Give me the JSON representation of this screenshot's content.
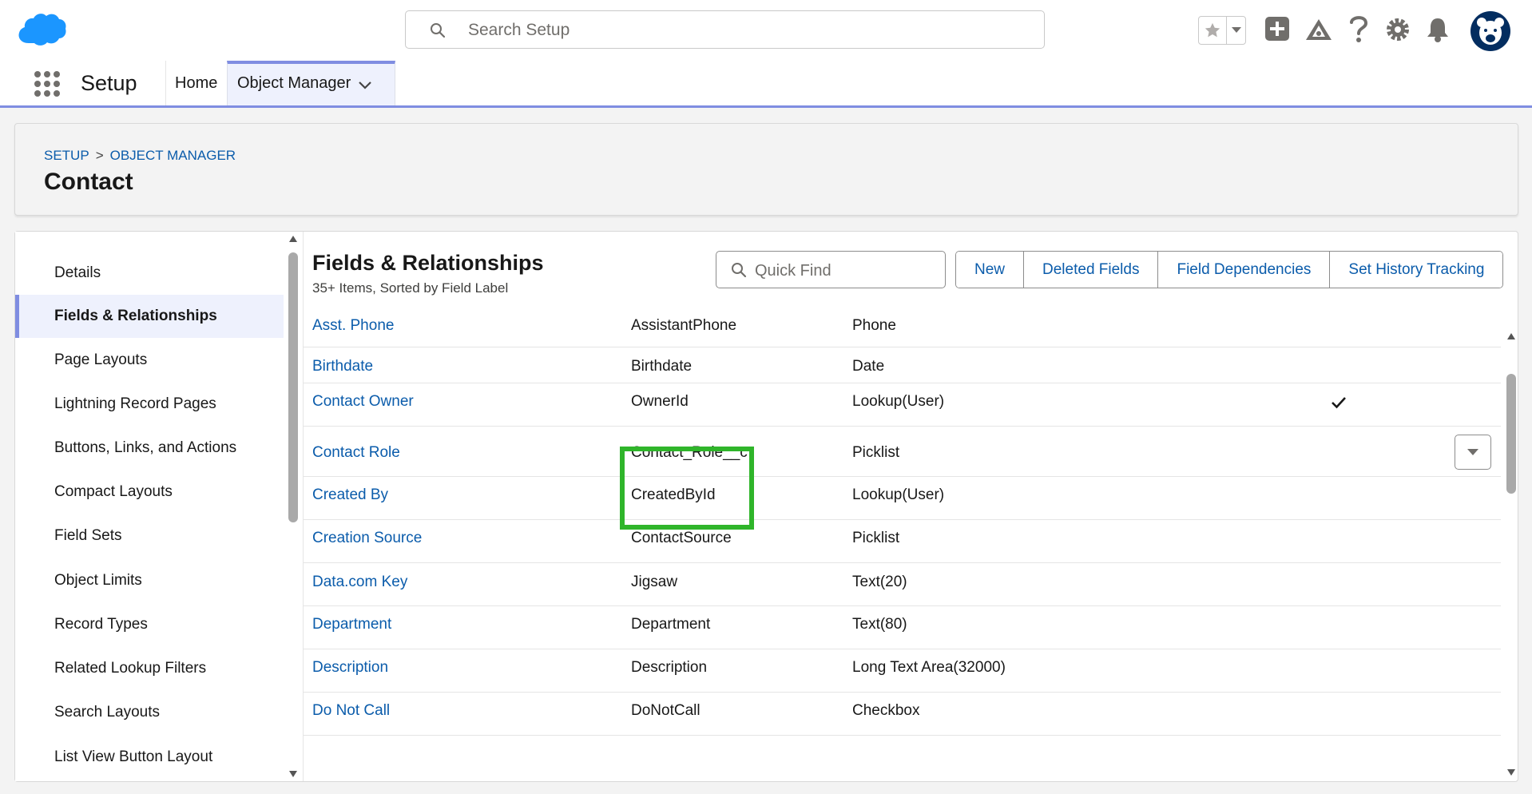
{
  "header": {
    "search_placeholder": "Search Setup"
  },
  "app_nav": {
    "app_name": "Setup",
    "tabs": [
      {
        "label": "Home"
      },
      {
        "label": "Object Manager"
      }
    ]
  },
  "page_header": {
    "breadcrumb": [
      "SETUP",
      "OBJECT MANAGER"
    ],
    "breadcrumb_sep": ">",
    "title": "Contact"
  },
  "sidebar": {
    "items": [
      {
        "label": "Details"
      },
      {
        "label": "Fields & Relationships",
        "active": true
      },
      {
        "label": "Page Layouts"
      },
      {
        "label": "Lightning Record Pages"
      },
      {
        "label": "Buttons, Links, and Actions"
      },
      {
        "label": "Compact Layouts"
      },
      {
        "label": "Field Sets"
      },
      {
        "label": "Object Limits"
      },
      {
        "label": "Record Types"
      },
      {
        "label": "Related Lookup Filters"
      },
      {
        "label": "Search Layouts"
      },
      {
        "label": "List View Button Layout"
      }
    ]
  },
  "section": {
    "title": "Fields & Relationships",
    "subtitle": "35+ Items, Sorted by Field Label",
    "quick_find_placeholder": "Quick Find",
    "buttons": [
      "New",
      "Deleted Fields",
      "Field Dependencies",
      "Set History Tracking"
    ]
  },
  "fields": [
    {
      "label": "Asst. Phone",
      "api_name": "AssistantPhone",
      "type": "Phone",
      "indexed": false
    },
    {
      "label": "Birthdate",
      "api_name": "Birthdate",
      "type": "Date",
      "indexed": false
    },
    {
      "label": "Contact Owner",
      "api_name": "OwnerId",
      "type": "Lookup(User)",
      "indexed": true
    },
    {
      "label": "Contact Role",
      "api_name": "Contact_Role__c",
      "type": "Picklist",
      "indexed": false,
      "has_action_menu": true
    },
    {
      "label": "Created By",
      "api_name": "CreatedById",
      "type": "Lookup(User)",
      "indexed": false
    },
    {
      "label": "Creation Source",
      "api_name": "ContactSource",
      "type": "Picklist",
      "indexed": false
    },
    {
      "label": "Data.com Key",
      "api_name": "Jigsaw",
      "type": "Text(20)",
      "indexed": false
    },
    {
      "label": "Department",
      "api_name": "Department",
      "type": "Text(80)",
      "indexed": false
    },
    {
      "label": "Description",
      "api_name": "Description",
      "type": "Long Text Area(32000)",
      "indexed": false
    },
    {
      "label": "Do Not Call",
      "api_name": "DoNotCall",
      "type": "Checkbox",
      "indexed": false
    }
  ],
  "colors": {
    "link": "#0b5cab",
    "accent": "#7f8de1",
    "highlight": "#2fb52a",
    "brand": "#1b96ff"
  }
}
